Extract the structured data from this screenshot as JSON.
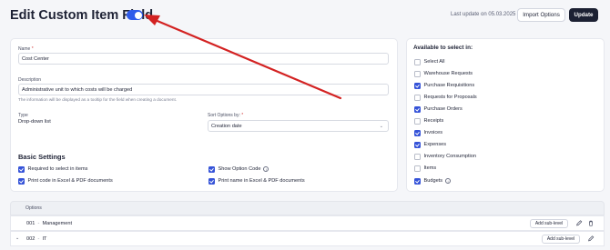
{
  "header": {
    "title": "Edit Custom Item Field",
    "last_update": "Last update on 05.03.2025",
    "import_label": "Import Options",
    "update_label": "Update"
  },
  "form": {
    "name_label": "Name",
    "name_required": "*",
    "name_value": "Cost Center",
    "description_label": "Description",
    "description_value": "Administrative unit to which costs will be charged",
    "description_hint": "The information will be displayed as a tooltip for the field when creating a document.",
    "type_label": "Type",
    "type_value": "Drop-down list",
    "sort_label": "Sort Options by:",
    "sort_required": "*",
    "sort_value": "Creation date"
  },
  "basic_settings": {
    "title": "Basic Settings",
    "items": [
      {
        "label": "Required to select in items",
        "checked": true
      },
      {
        "label": "Print code in Excel & PDF documents",
        "checked": true
      },
      {
        "label": "Show Option Code",
        "checked": true
      },
      {
        "label": "Print name in Excel & PDF documents",
        "checked": true
      }
    ]
  },
  "available": {
    "title": "Available to select in:",
    "items": [
      {
        "label": "Select All",
        "checked": false
      },
      {
        "label": "Warehouse Requests",
        "checked": false
      },
      {
        "label": "Purchase Requisitions",
        "checked": true
      },
      {
        "label": "Requests for Proposals",
        "checked": false
      },
      {
        "label": "Purchase Orders",
        "checked": true
      },
      {
        "label": "Receipts",
        "checked": false
      },
      {
        "label": "Invoices",
        "checked": true
      },
      {
        "label": "Expenses",
        "checked": true
      },
      {
        "label": "Inventory Consumption",
        "checked": false
      },
      {
        "label": "Items",
        "checked": false
      },
      {
        "label": "Budgets",
        "checked": true
      }
    ]
  },
  "options": {
    "header": "Options",
    "rows": [
      {
        "code": "001",
        "sep": "-",
        "name": "Management",
        "action": "Add sub-level"
      },
      {
        "code": "002",
        "sep": "-",
        "name": "IT",
        "action": "Add sub-level"
      }
    ]
  },
  "colors": {
    "accent": "#2f5bea",
    "arrow": "#d32222",
    "dark_button": "#1c2133"
  }
}
